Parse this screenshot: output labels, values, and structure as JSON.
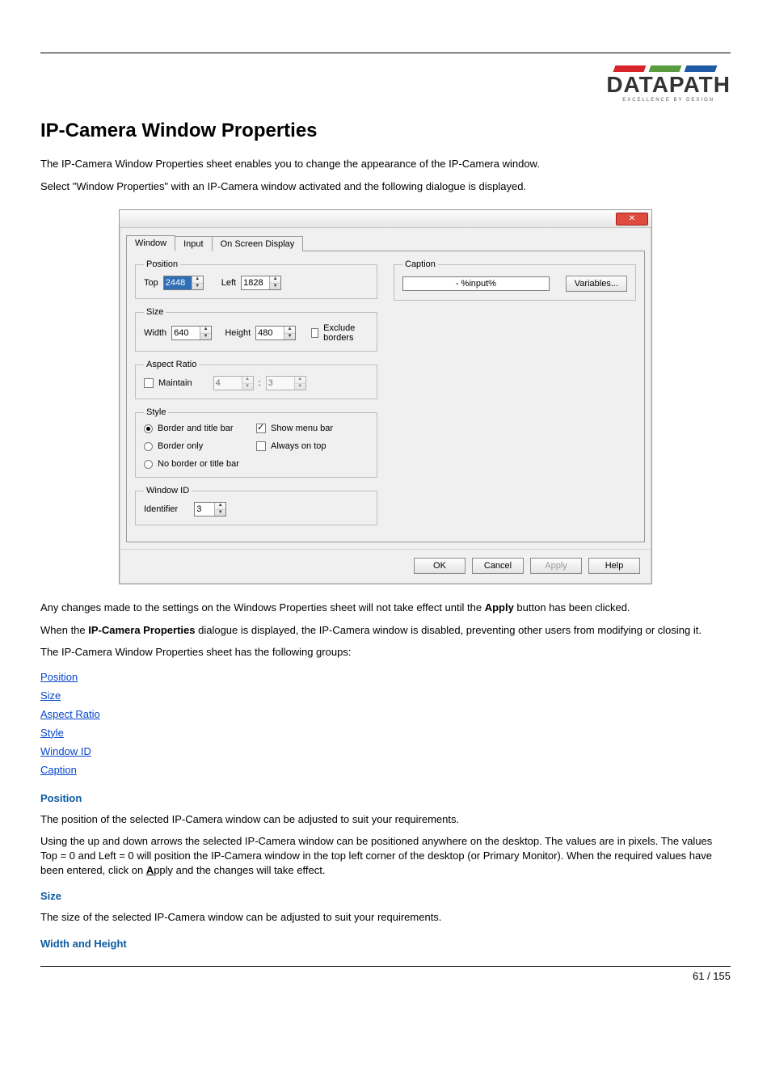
{
  "logo": {
    "name": "DATAPATH",
    "tagline": "EXCELLENCE BY DESIGN"
  },
  "title": "IP-Camera Window Properties",
  "intro1": "The IP-Camera Window Properties sheet enables you to change the appearance of the IP-Camera window.",
  "intro2": "Select \"Window Properties\" with an IP-Camera window activated and the following dialogue is displayed.",
  "dialog": {
    "tabs": {
      "t0": "Window",
      "t1": "Input",
      "t2": "On Screen Display"
    },
    "position": {
      "legend": "Position",
      "top_label": "Top",
      "top_value": "2448",
      "left_label": "Left",
      "left_value": "1828"
    },
    "size": {
      "legend": "Size",
      "width_label": "Width",
      "width_value": "640",
      "height_label": "Height",
      "height_value": "480",
      "exclude_label": "Exclude borders"
    },
    "aspect": {
      "legend": "Aspect Ratio",
      "maintain_label": "Maintain",
      "ratio_a": "4",
      "ratio_sep": ":",
      "ratio_b": "3"
    },
    "style": {
      "legend": "Style",
      "r_border_title": "Border and title bar",
      "r_border_only": "Border only",
      "r_no_border": "No border or title bar",
      "cb_menu": "Show menu bar",
      "cb_ontop": "Always on top"
    },
    "winid": {
      "legend": "Window ID",
      "id_label": "Identifier",
      "id_value": "3"
    },
    "caption": {
      "legend": "Caption",
      "value": " - %input%",
      "vars_button": "Variables..."
    },
    "buttons": {
      "ok": "OK",
      "cancel": "Cancel",
      "apply": "Apply",
      "help": "Help"
    }
  },
  "after1a": "Any changes made to the settings on the Windows Properties sheet will not take effect until the ",
  "after1b": "Apply",
  "after1c": " button has been clicked.",
  "after2a": "When the ",
  "after2b": "IP-Camera Properties",
  "after2c": " dialogue is displayed, the IP-Camera window is disabled, preventing other users from modifying or closing it.",
  "after3": "The IP-Camera Window Properties sheet has the following groups:",
  "links": {
    "l0": "Position",
    "l1": "Size",
    "l2": "Aspect Ratio",
    "l3": "Style",
    "l4": "Window ID",
    "l5": "Caption"
  },
  "sec_position": {
    "h": "Position",
    "p1": "The position of the selected IP-Camera window can be adjusted to suit your requirements.",
    "p2a": "Using the up and down arrows the selected IP-Camera window can be positioned anywhere on the desktop. The values are in pixels. The values Top = 0 and Left = 0 will position the IP-Camera window in the top left corner of the desktop (or Primary Monitor). When the required values have been entered, click on ",
    "p2b": "A",
    "p2c": "pply and the changes will take effect."
  },
  "sec_size": {
    "h": "Size",
    "p1": "The size of the selected IP-Camera window can be adjusted to suit your requirements."
  },
  "sec_wh": {
    "h": "Width and Height"
  },
  "pagenum": "61 / 155"
}
